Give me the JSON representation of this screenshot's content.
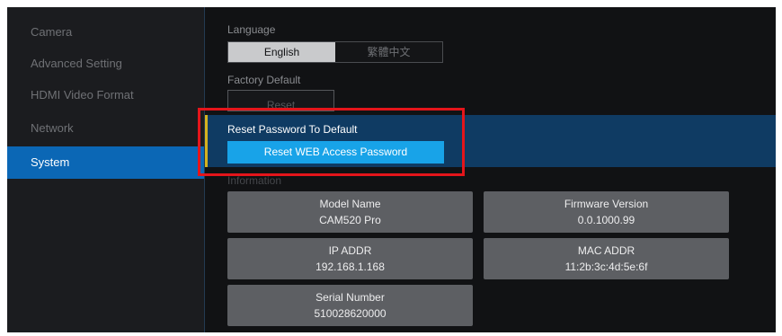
{
  "sidebar": {
    "items": [
      {
        "label": "Camera",
        "active": false
      },
      {
        "label": "Advanced Setting",
        "active": false
      },
      {
        "label": "HDMI Video Format",
        "active": false
      },
      {
        "label": "Network",
        "active": false
      },
      {
        "label": "System",
        "active": true
      }
    ]
  },
  "language": {
    "label": "Language",
    "options": [
      "English",
      "繁體中文"
    ],
    "selected": "English"
  },
  "factory_default": {
    "label": "Factory Default",
    "button_label": "Reset"
  },
  "reset_password": {
    "label": "Reset Password To Default",
    "button_label": "Reset WEB Access Password"
  },
  "information": {
    "label": "Information",
    "tiles": [
      {
        "title": "Model Name",
        "value": "CAM520 Pro"
      },
      {
        "title": "Firmware Version",
        "value": "0.0.1000.99"
      },
      {
        "title": "IP ADDR",
        "value": "192.168.1.168"
      },
      {
        "title": "MAC ADDR",
        "value": "11:2b:3c:4d:5e:6f"
      },
      {
        "title": "Serial Number",
        "value": "510028620000"
      }
    ]
  },
  "colors": {
    "accent": "#0b67b5",
    "highlight_row": "#0f3b63",
    "primary_button": "#18a3e8",
    "annotation_box": "#e4151b",
    "row_accent": "#d4b21f"
  }
}
